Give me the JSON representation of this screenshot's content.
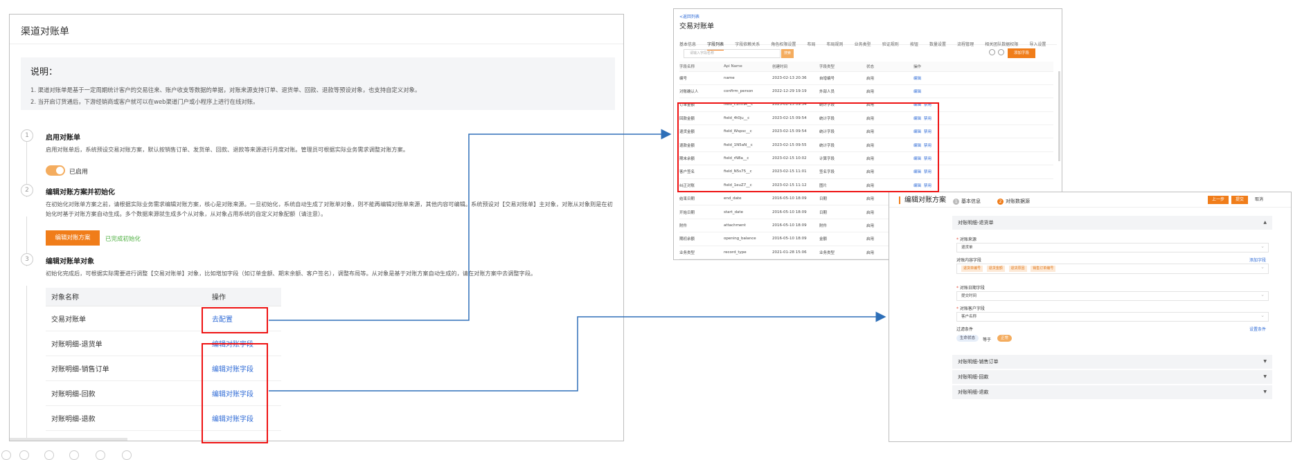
{
  "left": {
    "title": "渠道对账单",
    "note_title": "说明：",
    "note_lines": [
      "1. 渠道对账单是基于一定周期统计客户的交易往来、账户收支等数据的单据，对账来源支持订单、退货单、回款、退款等预设对象，也支持自定义对象。",
      "2. 当开启订货通后，下游经销商或客户就可以在web渠道门户或小程序上进行在线对账。"
    ],
    "step1": {
      "num": "1",
      "title": "启用对账单",
      "desc": "启用对账单后，系统预设交易对账方案，默认按销售订单、发货单、回款、退款等来源进行月度对账。管理员可根据实际业务需求调整对账方案。",
      "toggle_label": "已启用"
    },
    "step2": {
      "num": "2",
      "title": "编辑对账方案并初始化",
      "desc": "在初始化对账单方案之前，请根据实际业务需求编辑对账方案，核心是对账来源。一旦初始化，系统自动生成了对账单对象，则不能再编辑对账单来源，其他内容可编辑。系统预设对【交易对账单】主对象，对账从对象则是在初始化时基于对账方案自动生成。多个数据来源就生成多个从对象，从对象占用系统的自定义对象配额（请注意）。",
      "button": "编辑对账方案",
      "status": "已完成初始化"
    },
    "step3": {
      "num": "3",
      "title": "编辑对账单对象",
      "desc": "初始化完成后，可根据实际需要进行调整【交易对账单】对象，比如增加字段（如订单金额、期末余额、客户签名），调整布局等。从对象是基于对账方案自动生成的，请在对账方案中去调整字段。"
    },
    "table": {
      "headers": [
        "对象名称",
        "操作"
      ],
      "rows": [
        {
          "name": "交易对账单",
          "action": "去配置"
        },
        {
          "name": "对账明细-退货单",
          "action": "编辑对账字段"
        },
        {
          "name": "对账明细-销售订单",
          "action": "编辑对账字段"
        },
        {
          "name": "对账明细-回款",
          "action": "编辑对账字段"
        },
        {
          "name": "对账明细-退款",
          "action": "编辑对账字段"
        }
      ]
    }
  },
  "mid": {
    "back": "<返回列表",
    "title": "交易对账单",
    "tabs": [
      "基本信息",
      "字段列表",
      "字段依赖关系",
      "角色权限设置",
      "布局",
      "布局规则",
      "业务类型",
      "验证规则",
      "按钮",
      "数量设置",
      "流程管理",
      "相关团队数据权限",
      "导入设置"
    ],
    "active_tab": 1,
    "search_placeholder": "请输入字段名称",
    "search_btn": "搜索",
    "add_btn": "添加字段",
    "headers": [
      "字段名称",
      "Api Name",
      "创建时间",
      "字段类型",
      "状态",
      "操作"
    ],
    "rows": [
      [
        "编号",
        "name",
        "2023-02-13 20:36",
        "自增编号",
        "启用",
        "编辑"
      ],
      [
        "对账确认人",
        "confirm_person",
        "2022-12-29 19:19",
        "外部人员",
        "启用",
        "编辑"
      ],
      [
        "订单金额",
        "field_c1mnA__c",
        "2023-02-15 09:54",
        "统计字段",
        "启用",
        "编辑 禁用"
      ],
      [
        "回款金额",
        "field_4t0ju__c",
        "2023-02-15 09:54",
        "统计字段",
        "启用",
        "编辑 禁用"
      ],
      [
        "退货金额",
        "field_Wspsc__c",
        "2023-02-15 09:54",
        "统计字段",
        "启用",
        "编辑 禁用"
      ],
      [
        "退款金额",
        "field_1N5aN__c",
        "2023-02-15 09:55",
        "统计字段",
        "启用",
        "编辑 禁用"
      ],
      [
        "期末余额",
        "field_rN8a__c",
        "2023-02-15 10:02",
        "计算字段",
        "启用",
        "编辑 禁用"
      ],
      [
        "客户签名",
        "field_N5s75__c",
        "2023-02-15 11:01",
        "签名字段",
        "启用",
        "编辑 禁用"
      ],
      [
        "纠正对账",
        "field_1euZ7__c",
        "2023-02-15 11:12",
        "图片",
        "启用",
        "编辑 禁用"
      ],
      [
        "结束日期",
        "end_date",
        "2016-05-10 18:09",
        "日期",
        "启用",
        "编辑"
      ],
      [
        "开始日期",
        "start_date",
        "2016-05-10 18:09",
        "日期",
        "启用",
        "编辑"
      ],
      [
        "附件",
        "attachment",
        "2016-05-10 18:09",
        "附件",
        "启用",
        "编辑"
      ],
      [
        "期初余额",
        "opening_balance",
        "2016-05-10 18:09",
        "金额",
        "启用",
        "编辑"
      ],
      [
        "业务类型",
        "record_type",
        "2021-01-28 15:06",
        "业务类型",
        "启用",
        "编辑"
      ]
    ]
  },
  "right": {
    "title": "编辑对账方案",
    "step1": "基本信息",
    "step2": "对账数据源",
    "btn_prev": "上一步",
    "btn_save": "提交",
    "btn_cancel": "取消",
    "section1": "对账明细-退货单",
    "f_source_label": "对账来源",
    "f_source_value": "退货单",
    "f_content_label": "对账内容字段",
    "f_content_link": "添加字段",
    "content_tags": [
      "退货单编号",
      "退货金额",
      "退货原因",
      "销售订单编号"
    ],
    "f_date_label": "对账日期字段",
    "f_date_value": "提交时间",
    "f_customer_label": "对账客户字段",
    "f_customer_value": "客户名称",
    "f_filter_label": "过滤条件",
    "f_filter_link": "设置条件",
    "filter_field": "生命状态",
    "filter_op": "等于",
    "filter_value": "正常",
    "section2": "对账明细-销售订单",
    "section3": "对账明细-回款",
    "section4": "对账明细-退款"
  },
  "colors": {
    "accent": "#f07d1a",
    "link": "#2f6bd6",
    "annotation": "#e11111",
    "arrow": "#2e6fb8"
  }
}
